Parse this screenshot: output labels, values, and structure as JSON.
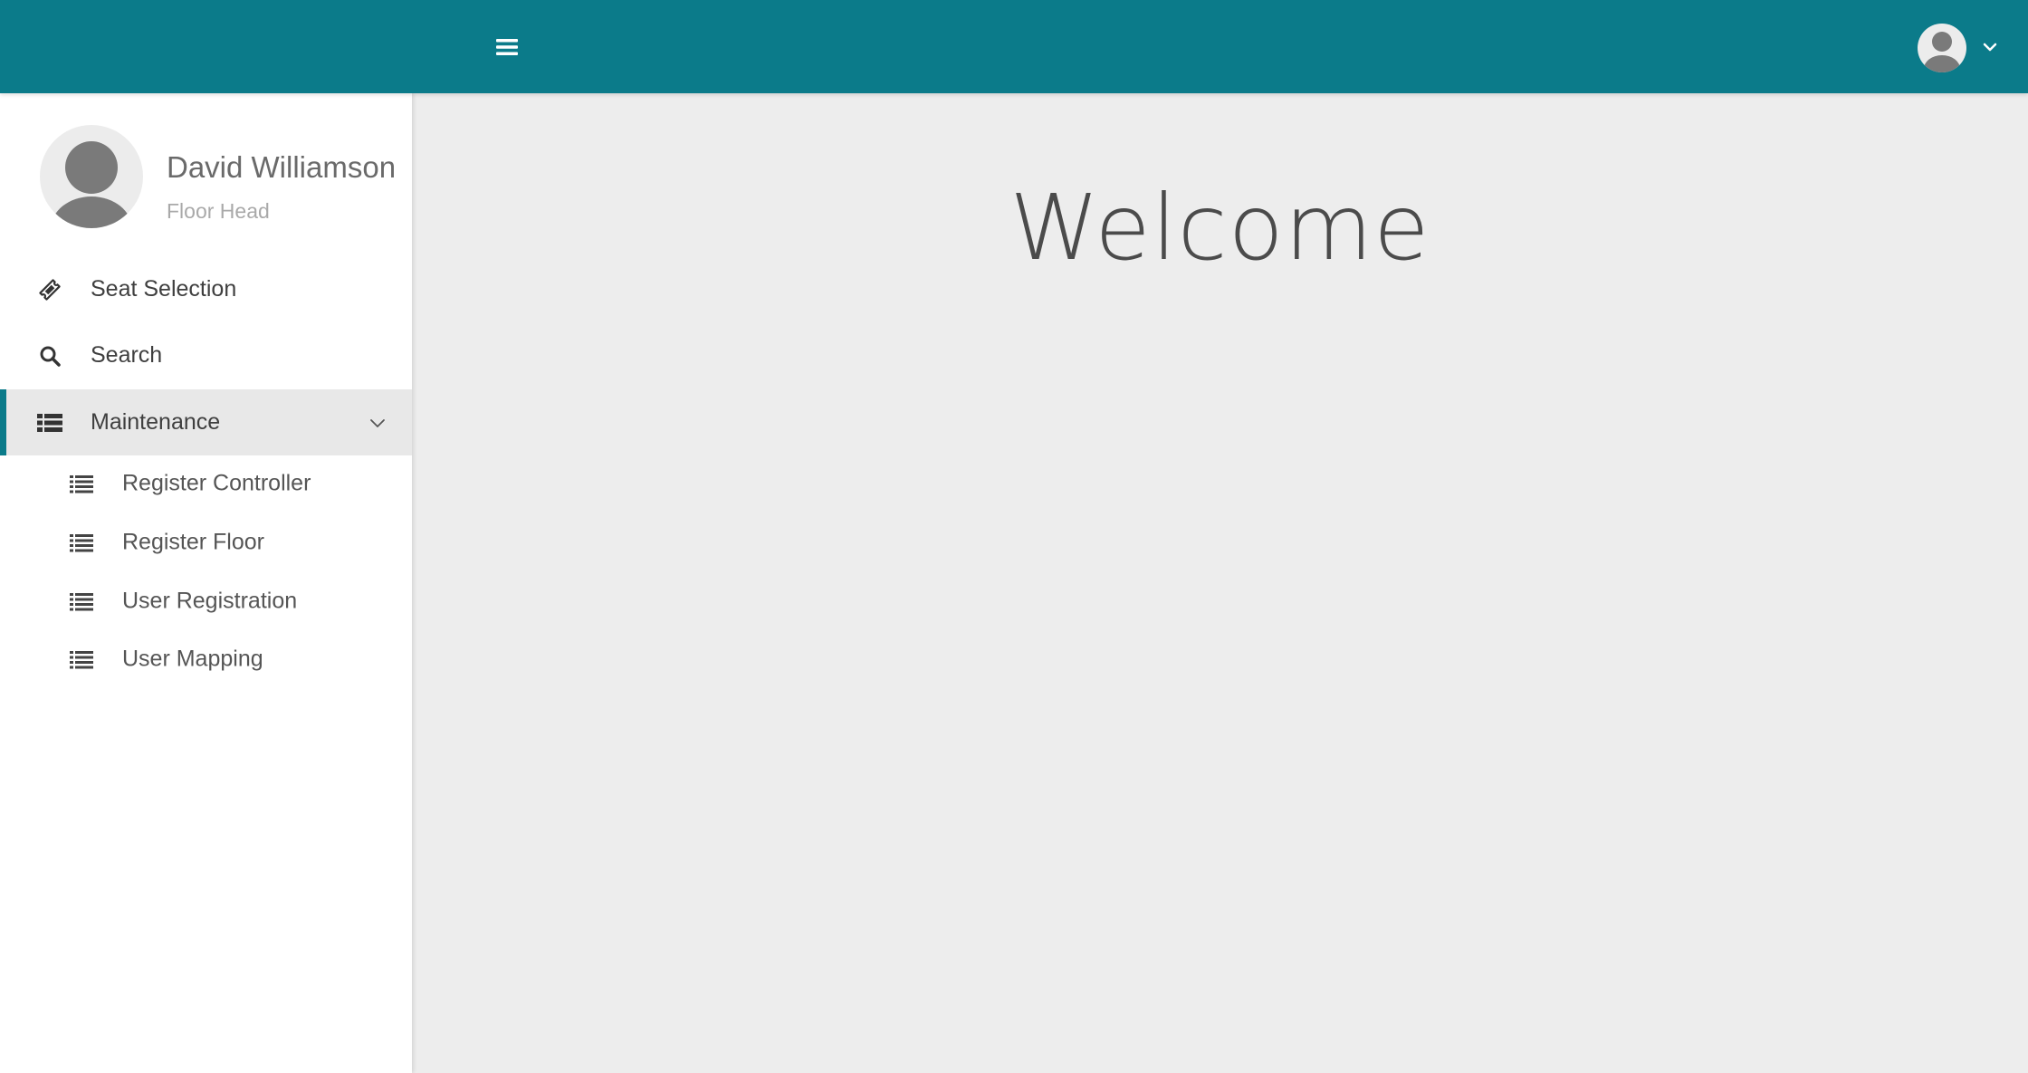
{
  "topbar": {
    "menu_icon": "hamburger-icon",
    "user_avatar_icon": "user-avatar-icon",
    "dropdown_icon": "chevron-down-icon",
    "background_color": "#0b7b8a"
  },
  "sidebar": {
    "profile": {
      "name": "David Williamson",
      "role": "Floor Head",
      "avatar_icon": "user-avatar-icon"
    },
    "items": [
      {
        "label": "Seat Selection",
        "icon": "ticket-icon"
      },
      {
        "label": "Search",
        "icon": "search-icon"
      },
      {
        "label": "Maintenance",
        "icon": "list-icon",
        "expanded": true,
        "active": true,
        "children": [
          {
            "label": "Register Controller",
            "icon": "list-icon"
          },
          {
            "label": "Register Floor",
            "icon": "list-icon"
          },
          {
            "label": "User Registration",
            "icon": "list-icon"
          },
          {
            "label": "User Mapping",
            "icon": "list-icon"
          }
        ]
      }
    ]
  },
  "main": {
    "heading": "Welcome"
  }
}
